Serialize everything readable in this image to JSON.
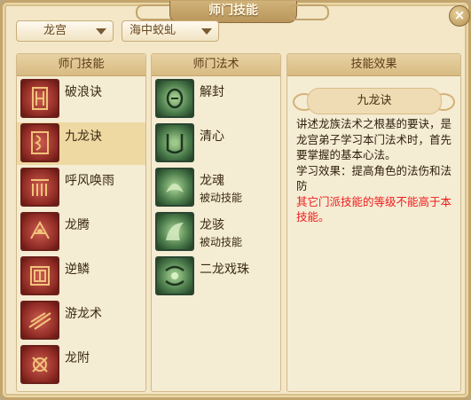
{
  "window": {
    "title": "师门技能",
    "close_label": "×"
  },
  "filters": {
    "sect": "龙宫",
    "category": "海中蛟虬"
  },
  "columns": {
    "skills": "师门技能",
    "spells": "师门法术",
    "effect": "技能效果"
  },
  "skills": [
    {
      "name": "破浪诀",
      "icon": "crest-icon"
    },
    {
      "name": "九龙诀",
      "icon": "rune-icon"
    },
    {
      "name": "呼风唤雨",
      "icon": "wind-rain-icon"
    },
    {
      "name": "龙腾",
      "icon": "dragon-rise-icon"
    },
    {
      "name": "逆鳞",
      "icon": "scale-icon"
    },
    {
      "name": "游龙术",
      "icon": "wandering-dragon-icon"
    },
    {
      "name": "龙附",
      "icon": "dragon-attach-icon"
    }
  ],
  "selected_skill": "九龙诀",
  "spells": [
    {
      "name": "解封",
      "sub": "",
      "icon": "unseal-icon"
    },
    {
      "name": "清心",
      "sub": "",
      "icon": "clear-mind-icon"
    },
    {
      "name": "龙魂",
      "sub": "被动技能",
      "icon": "dragon-soul-icon"
    },
    {
      "name": "龙骇",
      "sub": "被动技能",
      "icon": "dragon-fear-icon"
    },
    {
      "name": "二龙戏珠",
      "sub": "",
      "icon": "twin-dragons-icon"
    }
  ],
  "effect": {
    "title": "九龙诀",
    "line1": "讲述龙族法术之根基的要诀，是龙宫弟子学习本门法术时，首先要掌握的基本心法。",
    "line2": "学习效果：提高角色的法伤和法防",
    "line3": "其它门派技能的等级不能高于本技能。"
  },
  "colors": {
    "skill_icon": "#8e2a24",
    "spell_icon": "#4a7a4a",
    "warning": "#ef1c1c",
    "selection": "#efd9a2"
  }
}
